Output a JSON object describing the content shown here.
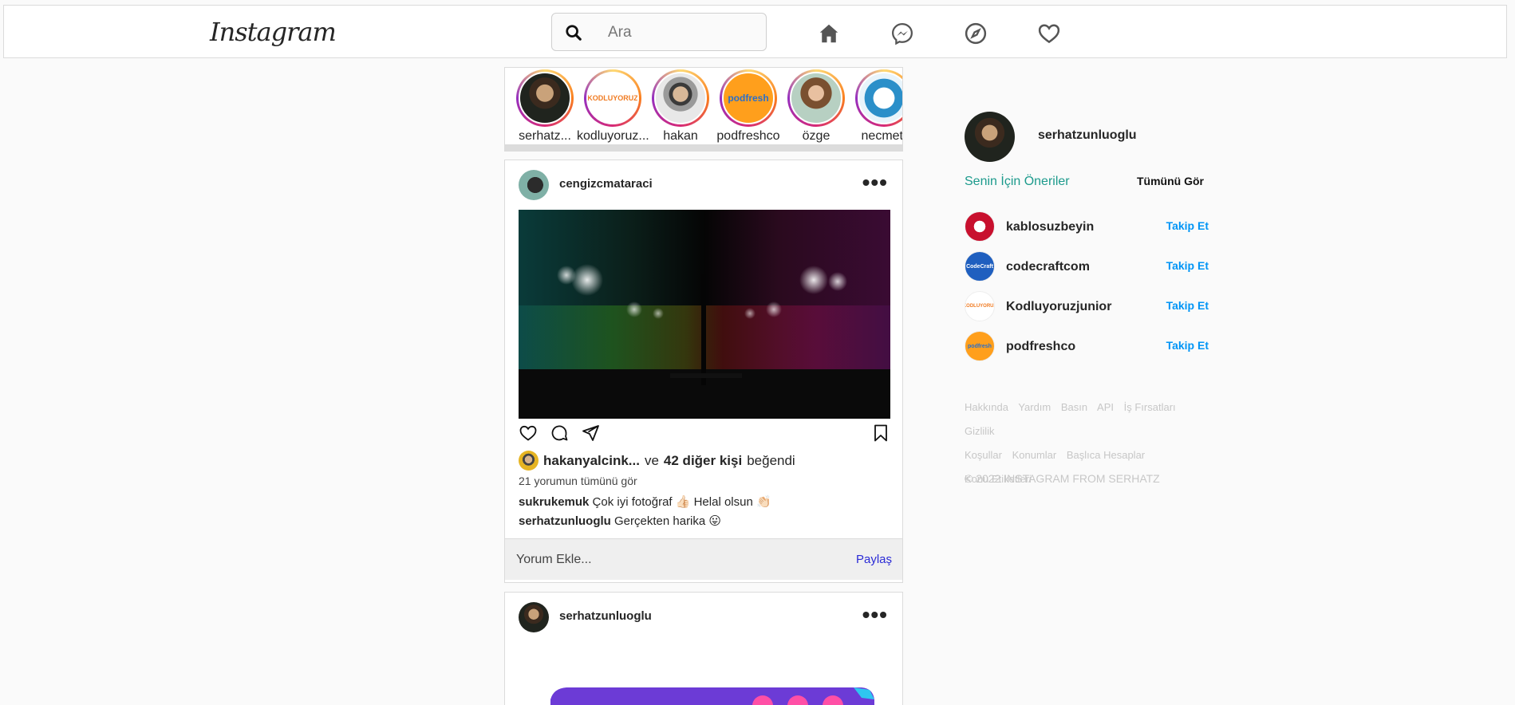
{
  "header": {
    "logo_text": "Instagram",
    "search_placeholder": "Ara",
    "nav_icons": [
      "home-icon",
      "messenger-icon",
      "explore-icon",
      "heart-icon"
    ]
  },
  "stories": [
    {
      "name": "serhatz..."
    },
    {
      "name": "kodluyoruz..."
    },
    {
      "name": "hakan"
    },
    {
      "name": "podfreshco"
    },
    {
      "name": "özge"
    },
    {
      "name": "necmett"
    }
  ],
  "posts": [
    {
      "username": "cengizcmataraci",
      "more_label": "•••",
      "liked_by": "hakanyalcink...",
      "liked_conj": "ve",
      "liked_others": "42 diğer kişi",
      "liked_suffix": "beğendi",
      "view_all_comments": "21 yorumun tümünü gör",
      "comments": [
        {
          "user": "sukrukemuk",
          "text": "Çok iyi fotoğraf 👍🏻 Helal olsun 👏🏻"
        },
        {
          "user": "serhatzunluoglu",
          "text": "Gerçekten harika 😛"
        }
      ],
      "comment_placeholder": "Yorum Ekle...",
      "share_label": "Paylaş"
    },
    {
      "username": "serhatzunluoglu",
      "more_label": "•••"
    }
  ],
  "sidebar": {
    "username": "serhatzunluoglu",
    "suggestions_title": "Senin İçin Öneriler",
    "see_all": "Tümünü Gör",
    "suggestions": [
      {
        "username": "kablosuzbeyin",
        "follow": "Takip Et"
      },
      {
        "username": "codecraftcom",
        "follow": "Takip Et",
        "avatar_text": "CodeCraft"
      },
      {
        "username": "Kodluyoruzjunior",
        "follow": "Takip Et"
      },
      {
        "username": "podfreshco",
        "follow": "Takip Et",
        "avatar_text": "podfresh"
      }
    ],
    "footer_links": [
      "Hakkında",
      "Yardım",
      "Basın",
      "API",
      "İş Fırsatları",
      "Gizlilik",
      "Koşullar",
      "Konumlar",
      "Başlıca Hesaplar",
      "Konu Etiketleri"
    ],
    "copyright": "© 2022 INSTAGRAM FROM SERHATZ"
  },
  "colors": {
    "link_blue": "#0095f6",
    "suggestion_teal": "#1c9a8c",
    "share_blue": "#2b2bd6"
  }
}
